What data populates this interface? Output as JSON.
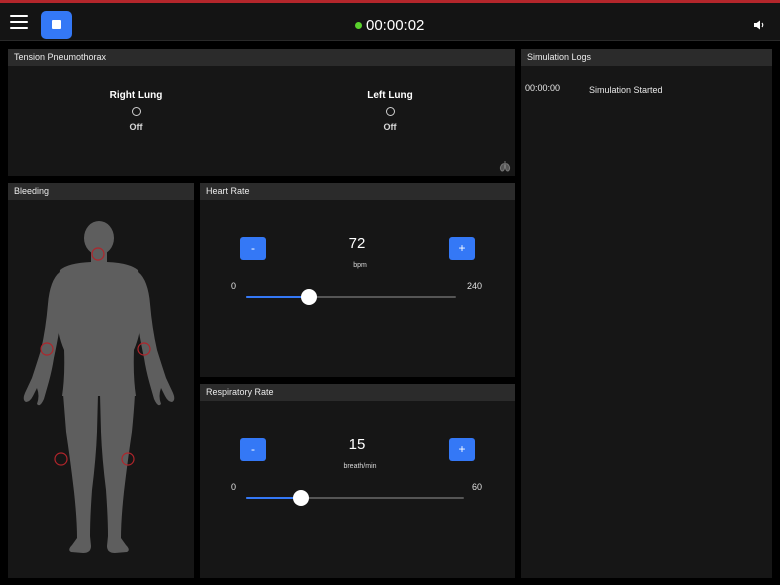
{
  "topbar": {
    "timer": "00:00:02",
    "status_color": "#59d12c",
    "stop_color": "#3478f6",
    "icons": [
      "menu-icon",
      "stop-icon",
      "speaker-icon"
    ]
  },
  "pneumothorax": {
    "title": "Tension Pneumothorax",
    "right": {
      "label": "Right Lung",
      "state": "Off"
    },
    "left": {
      "label": "Left Lung",
      "state": "Off"
    }
  },
  "bleeding": {
    "title": "Bleeding"
  },
  "heart_rate": {
    "title": "Heart Rate",
    "value": "72",
    "unit": "bpm",
    "min": "0",
    "max": "240",
    "minus_label": "-",
    "plus_label": "+",
    "level": 0.3
  },
  "respiratory_rate": {
    "title": "Respiratory Rate",
    "value": "15",
    "unit": "breath/min",
    "min": "0",
    "max": "60",
    "minus_label": "-",
    "plus_label": "+",
    "level": 0.25
  },
  "logs": {
    "title": "Simulation Logs",
    "entries": [
      {
        "time": "00:00:00",
        "message": "Simulation Started"
      }
    ]
  }
}
